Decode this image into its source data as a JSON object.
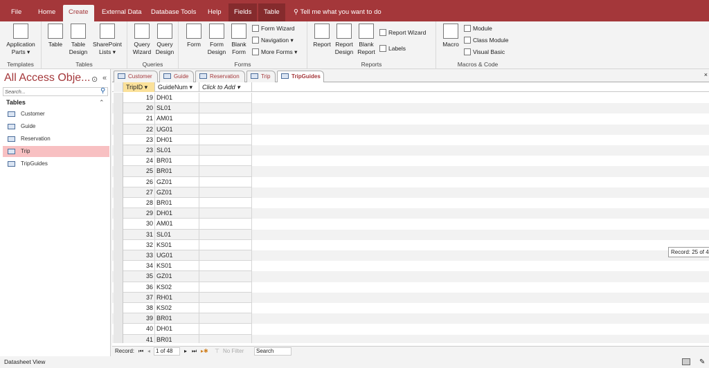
{
  "ribbon_tabs": [
    {
      "label": "File"
    },
    {
      "label": "Home"
    },
    {
      "label": "Create"
    },
    {
      "label": "External Data"
    },
    {
      "label": "Database Tools"
    },
    {
      "label": "Help"
    },
    {
      "label": "Fields"
    },
    {
      "label": "Table"
    }
  ],
  "tell_me": "Tell me what you want to do",
  "ribbon": {
    "templates": {
      "label": "Templates",
      "application_parts": "Application Parts ▾"
    },
    "tables": {
      "label": "Tables",
      "table": "Table",
      "table_design": "Table Design",
      "sharepoint_lists": "SharePoint Lists ▾"
    },
    "queries": {
      "label": "Queries",
      "query_wizard": "Query Wizard",
      "query_design": "Query Design"
    },
    "forms": {
      "label": "Forms",
      "form": "Form",
      "form_design": "Form Design",
      "blank_form": "Blank Form",
      "form_wizard": "Form Wizard",
      "navigation": "Navigation ▾",
      "more_forms": "More Forms ▾"
    },
    "reports": {
      "label": "Reports",
      "report": "Report",
      "report_design": "Report Design",
      "blank_report": "Blank Report",
      "report_wizard": "Report Wizard",
      "labels": "Labels"
    },
    "macros": {
      "label": "Macros & Code",
      "macro": "Macro",
      "module": "Module",
      "class_module": "Class Module",
      "visual_basic": "Visual Basic"
    }
  },
  "nav_pane": {
    "title": "All Access Obje...",
    "search_placeholder": "Search...",
    "section": "Tables",
    "items": [
      {
        "label": "Customer"
      },
      {
        "label": "Guide"
      },
      {
        "label": "Reservation"
      },
      {
        "label": "Trip"
      },
      {
        "label": "TripGuides"
      }
    ]
  },
  "doc_tabs": [
    {
      "label": "Customer"
    },
    {
      "label": "Guide"
    },
    {
      "label": "Reservation"
    },
    {
      "label": "Trip"
    },
    {
      "label": "TripGuides"
    }
  ],
  "table": {
    "columns": [
      "TripID ▾",
      "GuideNum ▾",
      "Click to Add ▾"
    ],
    "rows": [
      [
        "19",
        "DH01"
      ],
      [
        "20",
        "SL01"
      ],
      [
        "21",
        "AM01"
      ],
      [
        "22",
        "UG01"
      ],
      [
        "23",
        "DH01"
      ],
      [
        "23",
        "SL01"
      ],
      [
        "24",
        "BR01"
      ],
      [
        "25",
        "BR01"
      ],
      [
        "26",
        "GZ01"
      ],
      [
        "27",
        "GZ01"
      ],
      [
        "28",
        "BR01"
      ],
      [
        "29",
        "DH01"
      ],
      [
        "30",
        "AM01"
      ],
      [
        "31",
        "SL01"
      ],
      [
        "32",
        "KS01"
      ],
      [
        "33",
        "UG01"
      ],
      [
        "34",
        "KS01"
      ],
      [
        "35",
        "GZ01"
      ],
      [
        "36",
        "KS02"
      ],
      [
        "37",
        "RH01"
      ],
      [
        "38",
        "KS02"
      ],
      [
        "39",
        "BR01"
      ],
      [
        "40",
        "DH01"
      ],
      [
        "41",
        "BR01"
      ]
    ]
  },
  "record_nav": {
    "label": "Record:",
    "position": "1 of 48",
    "filter": "No Filter",
    "search": "Search"
  },
  "tooltip": "Record: 25 of 4",
  "status": "Datasheet View"
}
